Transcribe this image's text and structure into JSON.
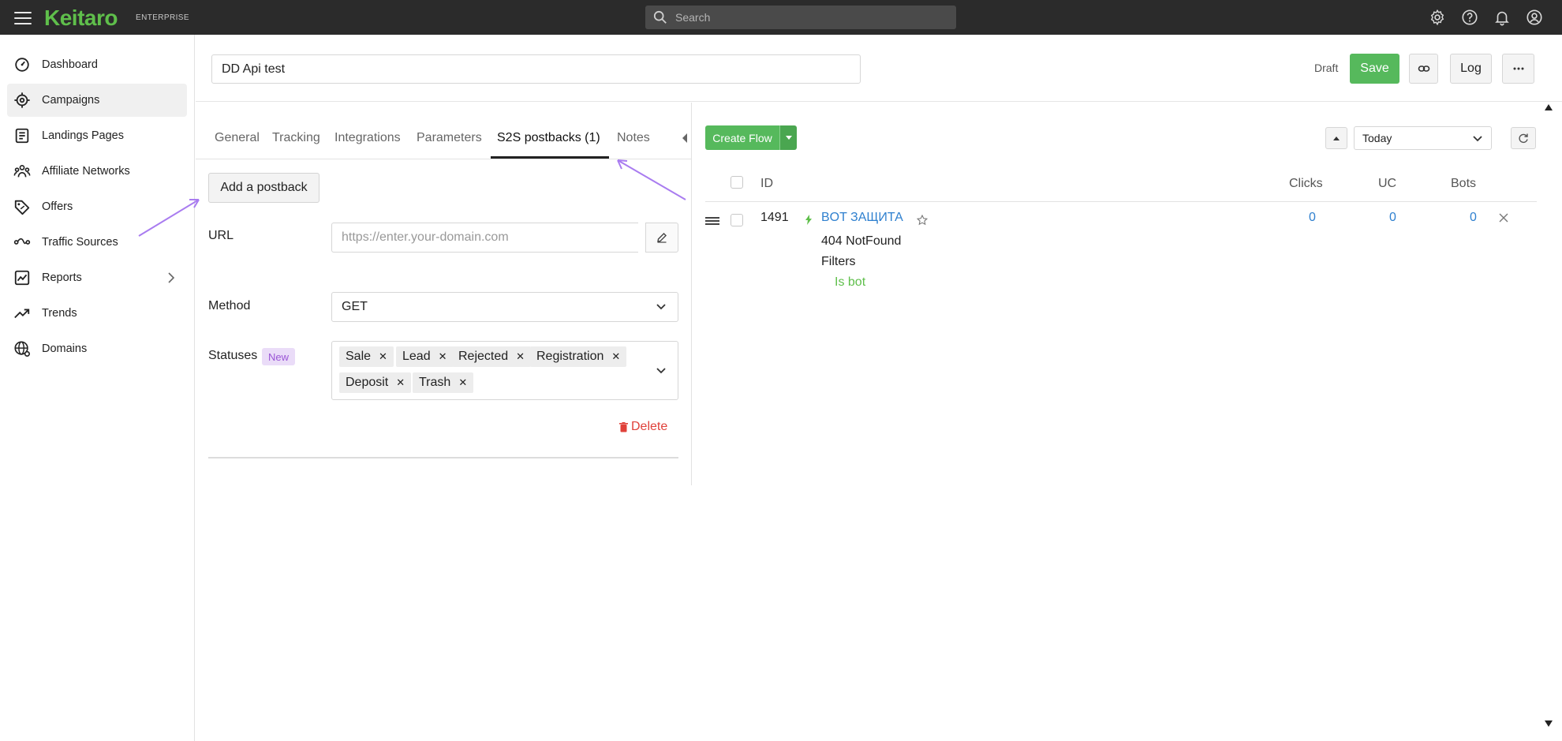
{
  "app": {
    "logo": "Keitaro",
    "logo_sub": "ENTERPRISE"
  },
  "search": {
    "placeholder": "Search"
  },
  "sidebar": {
    "items": [
      {
        "label": "Dashboard",
        "icon": "dashboard-icon"
      },
      {
        "label": "Campaigns",
        "icon": "campaigns-icon",
        "active": true
      },
      {
        "label": "Landings Pages",
        "icon": "landing-pages-icon"
      },
      {
        "label": "Affiliate Networks",
        "icon": "affiliate-networks-icon"
      },
      {
        "label": "Offers",
        "icon": "offers-icon"
      },
      {
        "label": "Traffic Sources",
        "icon": "traffic-sources-icon"
      },
      {
        "label": "Reports",
        "icon": "reports-icon"
      },
      {
        "label": "Trends",
        "icon": "trends-icon"
      },
      {
        "label": "Domains",
        "icon": "domains-icon"
      }
    ]
  },
  "header": {
    "campaign_name": "DD Api test",
    "status": "Draft",
    "save_label": "Save",
    "log_label": "Log"
  },
  "tabs": [
    {
      "label": "General"
    },
    {
      "label": "Tracking"
    },
    {
      "label": "Integrations"
    },
    {
      "label": "Parameters"
    },
    {
      "label": "S2S postbacks (1)",
      "active": true
    },
    {
      "label": "Notes"
    }
  ],
  "postback": {
    "add_label": "Add a postback",
    "url_label": "URL",
    "url_placeholder": "https://enter.your-domain.com",
    "method_label": "Method",
    "method_value": "GET",
    "statuses_label": "Statuses",
    "new_badge": "New",
    "statuses": [
      "Sale",
      "Lead",
      "Rejected",
      "Registration",
      "Deposit",
      "Trash"
    ],
    "delete_label": "Delete"
  },
  "flows": {
    "create_label": "Create Flow",
    "period": "Today",
    "columns": {
      "id": "ID",
      "clicks": "Clicks",
      "uc": "UC",
      "bots": "Bots"
    },
    "rows": [
      {
        "id": "1491",
        "name": "BOT ЗАЩИТА",
        "subtitle": "404 NotFound",
        "filters_label": "Filters",
        "filter": "Is bot",
        "clicks": "0",
        "uc": "0",
        "bots": "0"
      }
    ]
  },
  "colors": {
    "brand": "#5fbf4b",
    "accent": "#56b95c",
    "link": "#2f80cf",
    "danger": "#e0413a",
    "annotation": "#a97cf0"
  }
}
